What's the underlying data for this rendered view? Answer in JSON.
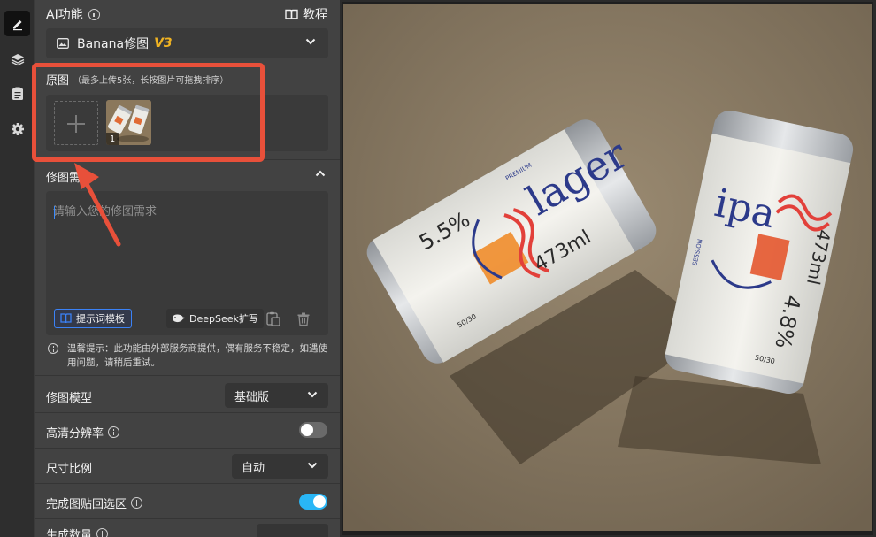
{
  "rail": {
    "items": [
      {
        "name": "edit",
        "active": true
      },
      {
        "name": "layers",
        "active": false
      },
      {
        "name": "document",
        "active": false
      },
      {
        "name": "settings",
        "active": false
      }
    ]
  },
  "header": {
    "title": "AI功能",
    "tutorial_label": "教程"
  },
  "model_select": {
    "label": "Banana修图",
    "version": "V3"
  },
  "original": {
    "label": "原图",
    "hint": "（最多上传5张，长按图片可拖拽排序）",
    "thumbnail_index": "1"
  },
  "request": {
    "label": "修图需求",
    "placeholder": "请输入您的修图需求",
    "template_button": "提示词模板",
    "deepseek_button": "DeepSeek扩写"
  },
  "notice": "温馨提示：此功能由外部服务商提供，偶有服务不稳定，如遇使用问题，请稍后重试。",
  "settings": {
    "model_label": "修图模型",
    "model_value": "基础版",
    "hd_label": "高清分辨率",
    "hd_enabled": false,
    "ratio_label": "尺寸比例",
    "ratio_value": "自动",
    "paste_back_label": "完成图贴回选区",
    "paste_back_enabled": true,
    "count_label": "生成数量"
  },
  "photo": {
    "can_left": {
      "brand": "lager",
      "abv": "5.5%",
      "volume": "473ml",
      "tag": "PREMIUM",
      "count": "50/30"
    },
    "can_right": {
      "brand": "ipa",
      "abv": "4.8%",
      "volume": "473ml",
      "tag": "SESSION",
      "count": "50/30"
    }
  },
  "colors": {
    "accent_blue": "#3b82f6",
    "toggle_on": "#29b6f6",
    "annotation_red": "#e8503a",
    "version_gold": "#f0b322"
  }
}
